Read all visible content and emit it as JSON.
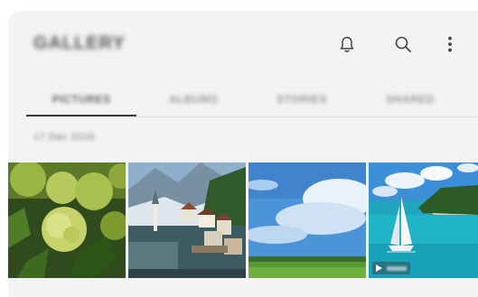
{
  "header": {
    "title": "GALLERY",
    "icons": [
      "bell-icon",
      "search-icon",
      "more-vertical-icon"
    ]
  },
  "tabs": [
    {
      "label": "PICTURES",
      "active": true
    },
    {
      "label": "ALBUMS",
      "active": false
    },
    {
      "label": "STORIES",
      "active": false
    },
    {
      "label": "SHARED",
      "active": false
    }
  ],
  "date_header": "17 Dec 2016",
  "thumbnails": [
    {
      "subject": "green hydrangea flowers"
    },
    {
      "subject": "lakeside alpine village"
    },
    {
      "subject": "blue sky and meadow"
    },
    {
      "subject": "sailboat on turquoise sea",
      "is_video": true
    }
  ],
  "colors": {
    "background": "#f3f3f3",
    "text": "#555555",
    "underline": "#3a3a3a"
  }
}
